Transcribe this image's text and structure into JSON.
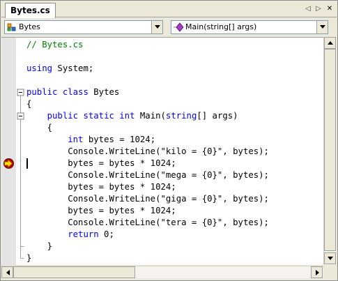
{
  "tab": {
    "title": "Bytes.cs"
  },
  "tab_controls": {
    "prev": "◁",
    "next": "▷",
    "close": "✕"
  },
  "nav": {
    "class_combo": {
      "value": "Bytes",
      "icon": "class-icon"
    },
    "member_combo": {
      "value": "Main(string[] args)",
      "icon": "method-icon"
    }
  },
  "code": {
    "lines": [
      [
        {
          "t": "// Bytes.cs",
          "c": "cm"
        }
      ],
      [],
      [
        {
          "t": "using",
          "c": "kw"
        },
        {
          "t": " System;"
        }
      ],
      [],
      [
        {
          "t": "public",
          "c": "kw"
        },
        {
          "t": " "
        },
        {
          "t": "class",
          "c": "kw"
        },
        {
          "t": " Bytes"
        }
      ],
      [
        {
          "t": "{"
        }
      ],
      [
        {
          "t": "    "
        },
        {
          "t": "public",
          "c": "kw"
        },
        {
          "t": " "
        },
        {
          "t": "static",
          "c": "kw"
        },
        {
          "t": " "
        },
        {
          "t": "int",
          "c": "kw"
        },
        {
          "t": " Main("
        },
        {
          "t": "string",
          "c": "kw"
        },
        {
          "t": "[] args)"
        }
      ],
      [
        {
          "t": "    {"
        }
      ],
      [
        {
          "t": "        "
        },
        {
          "t": "int",
          "c": "kw"
        },
        {
          "t": " bytes = 1024;"
        }
      ],
      [
        {
          "t": "        Console.WriteLine(\"kilo = {0}\", bytes);"
        }
      ],
      [
        {
          "t": "        bytes = bytes * 1024;"
        }
      ],
      [
        {
          "t": "        Console.WriteLine(\"mega = {0}\", bytes);"
        }
      ],
      [
        {
          "t": "        bytes = bytes * 1024;"
        }
      ],
      [
        {
          "t": "        Console.WriteLine(\"giga = {0}\", bytes);"
        }
      ],
      [
        {
          "t": "        bytes = bytes * 1024;"
        }
      ],
      [
        {
          "t": "        Console.WriteLine(\"tera = {0}\", bytes);"
        }
      ],
      [
        {
          "t": "        "
        },
        {
          "t": "return",
          "c": "kw"
        },
        {
          "t": " 0;"
        }
      ],
      [
        {
          "t": "    }"
        }
      ],
      [
        {
          "t": "}"
        }
      ]
    ],
    "current_line_index": 10,
    "breakpoint_line_index": 10,
    "collapse_markers": [
      4,
      6
    ]
  },
  "colors": {
    "keyword": "#0000ff",
    "comment": "#008000",
    "breakpoint": "#c00000",
    "arrow": "#ffd800"
  }
}
